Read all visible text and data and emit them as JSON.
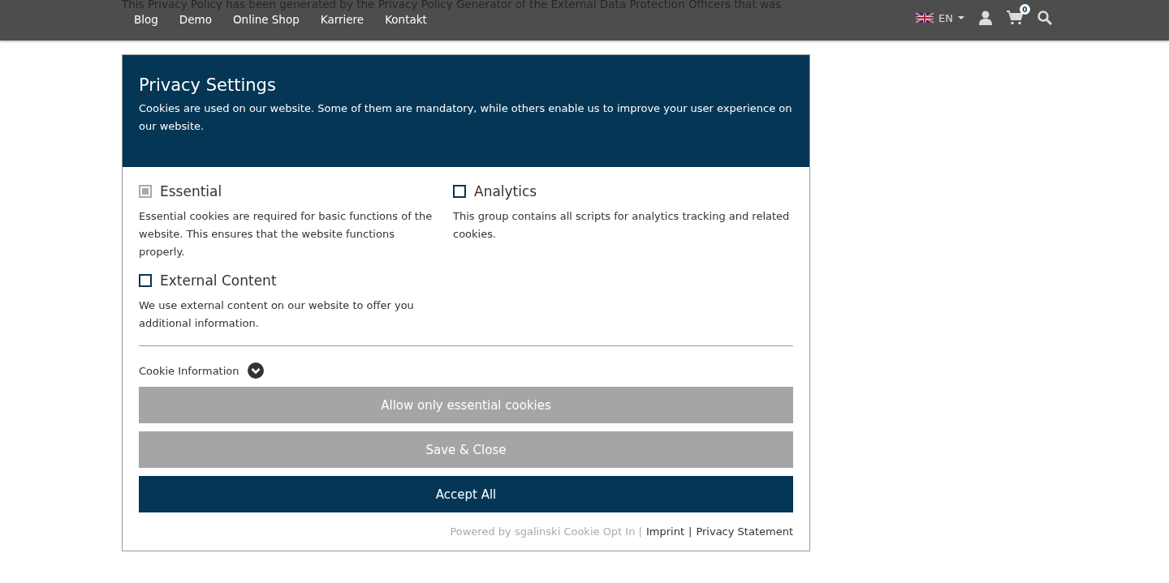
{
  "background_text": "This Privacy Policy has been generated by the Privacy Policy Generator of the External Data Protection Officers that was",
  "nav": {
    "items": [
      "Blog",
      "Demo",
      "Online Shop",
      "Karriere",
      "Kontakt"
    ],
    "language": "EN",
    "cart_count": "0"
  },
  "modal": {
    "title": "Privacy Settings",
    "intro": "Cookies are used on our website. Some of them are mandatory, while others enable us to improve your user experience on our website.",
    "groups": [
      {
        "label": "Essential",
        "checked": true,
        "disabled": true,
        "description": "Essential cookies are required for basic functions of the website. This ensures that the website functions properly."
      },
      {
        "label": "Analytics",
        "checked": false,
        "disabled": false,
        "description": "This group contains all scripts for analytics tracking and related cookies."
      },
      {
        "label": "External Content",
        "checked": false,
        "disabled": false,
        "description": "We use external content on our website to offer you additional information."
      }
    ],
    "cookie_info": {
      "label": "Cookie Information",
      "expanded": false
    },
    "buttons": [
      {
        "label": "Allow only essential cookies",
        "kind": "secondary"
      },
      {
        "label": "Save & Close",
        "kind": "secondary"
      },
      {
        "label": "Accept All",
        "kind": "primary"
      }
    ],
    "footer": {
      "powered": "Powered by sgalinski Cookie Opt In |",
      "links": [
        "Imprint",
        "Privacy Statement"
      ],
      "separator": "|"
    }
  }
}
